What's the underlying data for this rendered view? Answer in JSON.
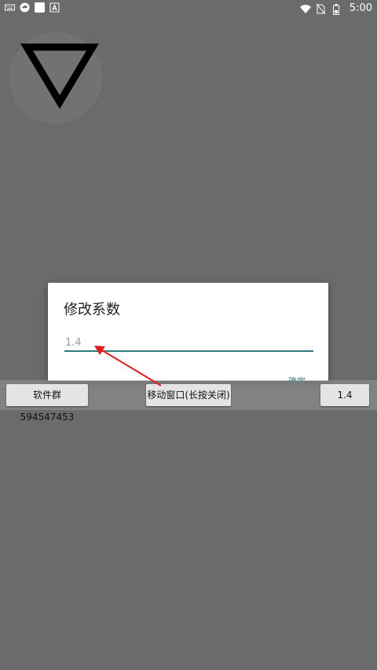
{
  "status_bar": {
    "time": "5:00",
    "icons": [
      "keyboard-icon",
      "cloud-icon",
      "square-app-icon",
      "notification-a-icon",
      "wifi-icon",
      "no-sim-icon",
      "battery-icon"
    ]
  },
  "app": {
    "logo_icon": "inverted-triangle-logo-icon"
  },
  "dialog": {
    "title": "修改系数",
    "input_value": "1.4",
    "ok_label": "确定",
    "accent_color": "#2e7d7e"
  },
  "floating_bar": {
    "group_label": "软件群594547453",
    "move_label": "移动窗口(长按关闭)",
    "value_label": "1.4"
  },
  "annotation": {
    "arrow_color": "#e02020"
  }
}
